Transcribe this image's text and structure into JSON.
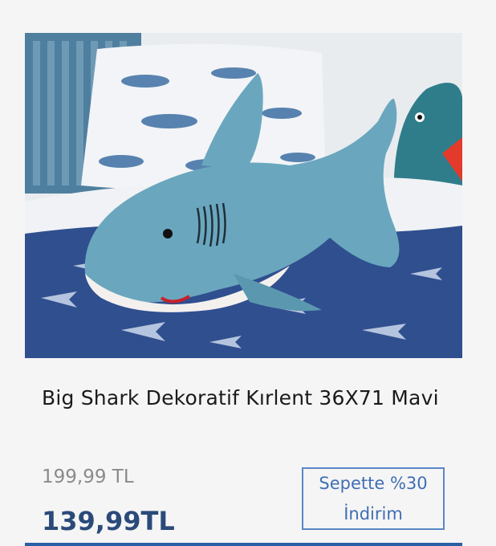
{
  "product": {
    "image_alt": "Big Shark Dekoratif Kırlent 36X71 Mavi",
    "title": "Big Shark Dekoratif Kırlent 36X71 Mavi",
    "old_price": "199,99 TL",
    "new_price": "139,99TL",
    "badge_line1": "Sepette %30",
    "badge_line2": "İndirim"
  },
  "colors": {
    "price_accent": "#2b4a7a",
    "badge_border": "#5a86c6",
    "badge_text": "#3f6fb5",
    "old_price": "#8a8a8a",
    "background": "#f5f5f5"
  }
}
